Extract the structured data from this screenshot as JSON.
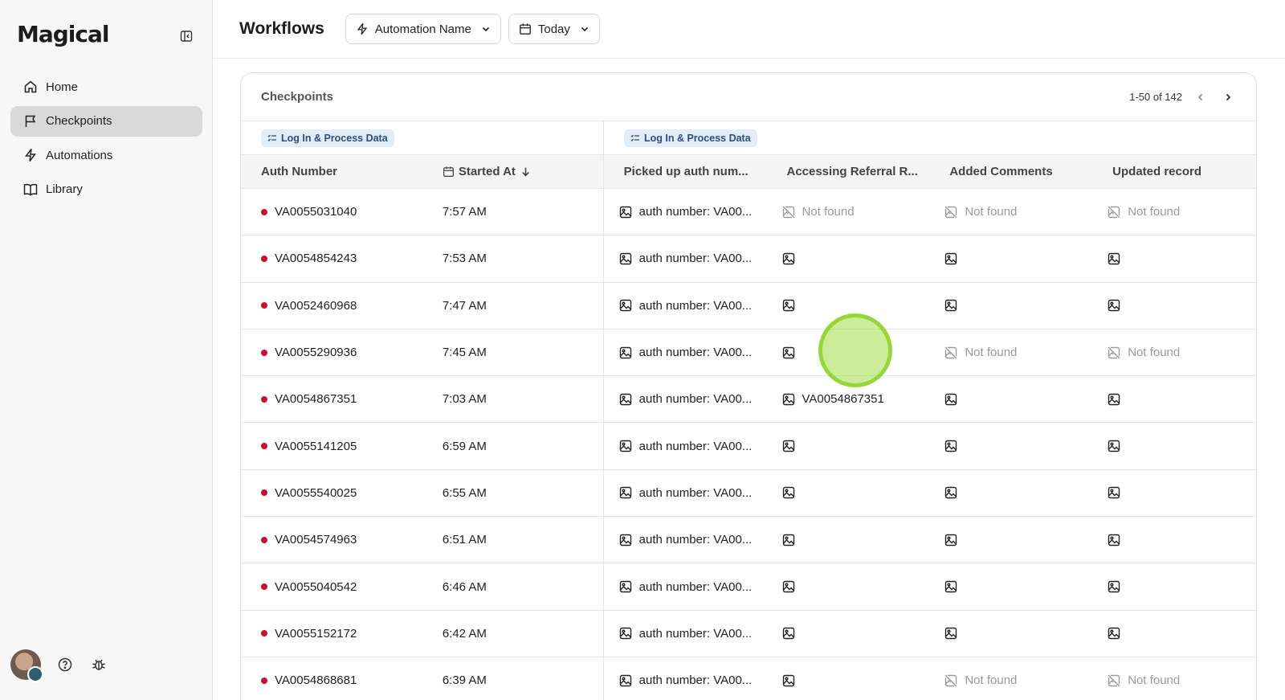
{
  "app": {
    "logo": "Magical"
  },
  "sidebar": {
    "items": [
      {
        "label": "Home",
        "icon": "home-icon"
      },
      {
        "label": "Checkpoints",
        "icon": "flag-icon",
        "active": true
      },
      {
        "label": "Automations",
        "icon": "bolt-icon"
      },
      {
        "label": "Library",
        "icon": "book-icon"
      }
    ]
  },
  "header": {
    "title": "Workflows",
    "filters": [
      {
        "label": "Automation Name",
        "icon": "bolt-icon"
      },
      {
        "label": "Today",
        "icon": "calendar-icon"
      }
    ]
  },
  "card": {
    "title": "Checkpoints",
    "pagination": "1-50 of 142",
    "groups": [
      "Log In & Process Data",
      "Log In & Process Data"
    ],
    "columns": [
      "Auth Number",
      "Started At",
      "Picked up auth num...",
      "Accessing Referral R...",
      "Added Comments",
      "Updated record"
    ],
    "rows": [
      {
        "auth": "VA0055031040",
        "time": "7:57 AM",
        "c3": "auth number: VA00...",
        "c4": "Not found",
        "c5": "Not found",
        "c6": "Not found"
      },
      {
        "auth": "VA0054854243",
        "time": "7:53 AM",
        "c3": "auth number: VA00...",
        "c4": "",
        "c5": "",
        "c6": ""
      },
      {
        "auth": "VA0052460968",
        "time": "7:47 AM",
        "c3": "auth number: VA00...",
        "c4": "",
        "c5": "",
        "c6": ""
      },
      {
        "auth": "VA0055290936",
        "time": "7:45 AM",
        "c3": "auth number: VA00...",
        "c4": "",
        "c5": "Not found",
        "c6": "Not found"
      },
      {
        "auth": "VA0054867351",
        "time": "7:03 AM",
        "c3": "auth number: VA00...",
        "c4": "VA0054867351",
        "c5": "",
        "c6": ""
      },
      {
        "auth": "VA0055141205",
        "time": "6:59 AM",
        "c3": "auth number: VA00...",
        "c4": "",
        "c5": "",
        "c6": ""
      },
      {
        "auth": "VA0055540025",
        "time": "6:55 AM",
        "c3": "auth number: VA00...",
        "c4": "",
        "c5": "",
        "c6": ""
      },
      {
        "auth": "VA0054574963",
        "time": "6:51 AM",
        "c3": "auth number: VA00...",
        "c4": "",
        "c5": "",
        "c6": ""
      },
      {
        "auth": "VA0055040542",
        "time": "6:46 AM",
        "c3": "auth number: VA00...",
        "c4": "",
        "c5": "",
        "c6": ""
      },
      {
        "auth": "VA0055152172",
        "time": "6:42 AM",
        "c3": "auth number: VA00...",
        "c4": "",
        "c5": "",
        "c6": ""
      },
      {
        "auth": "VA0054868681",
        "time": "6:39 AM",
        "c3": "auth number: VA00...",
        "c4": "",
        "c5": "Not found",
        "c6": "Not found"
      }
    ]
  },
  "colors": {
    "status_dot": "#c8102e",
    "active_nav": "#d9d9d9",
    "tag_bg": "#e3edf9",
    "click_indicator": "#a0dc46"
  }
}
